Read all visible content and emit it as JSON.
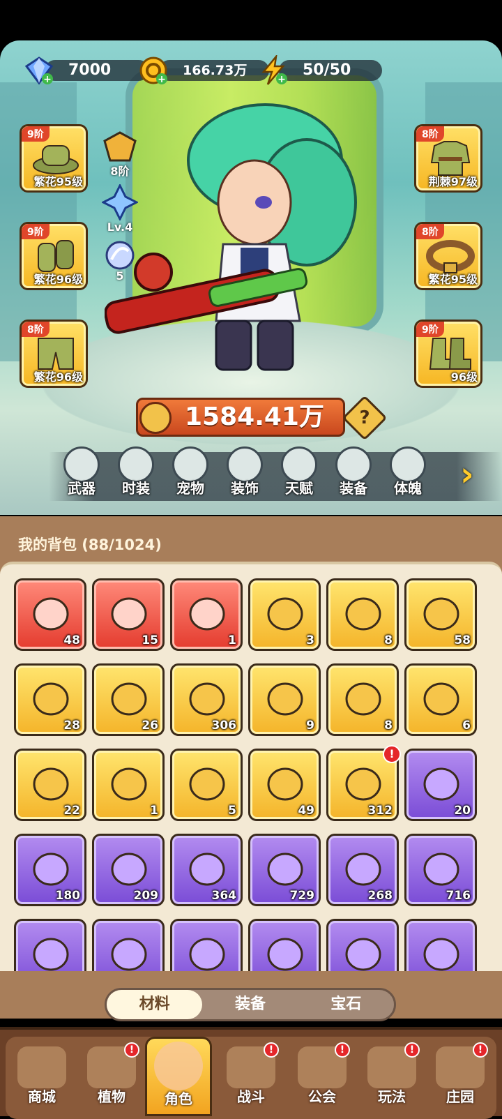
{
  "resources": {
    "diamonds": "7000",
    "gold": "166.73万",
    "energy": "50/50"
  },
  "left_equipment": [
    {
      "tier": "9阶",
      "label": "繁花95级",
      "icon": "hat-icon"
    },
    {
      "tier": "9阶",
      "label": "繁花96级",
      "icon": "gloves-icon"
    },
    {
      "tier": "8阶",
      "label": "繁花96级",
      "icon": "pants-icon"
    }
  ],
  "right_equipment": [
    {
      "tier": "8阶",
      "label": "荆棘97级",
      "icon": "jacket-icon"
    },
    {
      "tier": "8阶",
      "label": "繁花95级",
      "icon": "belt-icon"
    },
    {
      "tier": "9阶",
      "label": "96级",
      "icon": "boots-icon"
    }
  ],
  "side_gems": {
    "tier": "8阶",
    "level": "Lv.4",
    "count": "5"
  },
  "power": "1584.41万",
  "char_tabs": [
    "武器",
    "时装",
    "宠物",
    "装饰",
    "天赋",
    "装备",
    "体魄"
  ],
  "bag": {
    "title": "我的背包 (88/1024)"
  },
  "items": [
    {
      "count": "48",
      "rarity": "red",
      "icon": "crystal-star-icon"
    },
    {
      "count": "15",
      "rarity": "red",
      "icon": "red-potion-icon"
    },
    {
      "count": "1",
      "rarity": "red",
      "icon": "green-capsule-icon"
    },
    {
      "count": "3",
      "rarity": "gold",
      "icon": "skull-scroll-icon"
    },
    {
      "count": "8",
      "rarity": "gold",
      "icon": "key-icon"
    },
    {
      "count": "58",
      "rarity": "gold",
      "icon": "prism-icon"
    },
    {
      "count": "28",
      "rarity": "gold",
      "icon": "golden-flower-icon"
    },
    {
      "count": "26",
      "rarity": "gold",
      "icon": "rune-stone-icon"
    },
    {
      "count": "306",
      "rarity": "gold",
      "icon": "orange-potion-icon"
    },
    {
      "count": "9",
      "rarity": "gold",
      "icon": "sand-pile-icon"
    },
    {
      "count": "8",
      "rarity": "gold",
      "icon": "gold-ore-icon"
    },
    {
      "count": "6",
      "rarity": "gold",
      "icon": "flower-pot-icon"
    },
    {
      "count": "22",
      "rarity": "gold",
      "icon": "spell-book-icon"
    },
    {
      "count": "1",
      "rarity": "gold",
      "icon": "copper-gem-icon"
    },
    {
      "count": "5",
      "rarity": "gold",
      "icon": "lily-icon"
    },
    {
      "count": "49",
      "rarity": "gold",
      "icon": "knot-cookie-icon"
    },
    {
      "count": "312",
      "rarity": "gold",
      "icon": "mystery-flame-icon",
      "alert": "!"
    },
    {
      "count": "20",
      "rarity": "purple",
      "icon": "purple-potion-icon"
    },
    {
      "count": "180",
      "rarity": "purple",
      "icon": "badge-icon"
    },
    {
      "count": "209",
      "rarity": "purple",
      "icon": "leaf-icon"
    },
    {
      "count": "364",
      "rarity": "purple",
      "icon": "scroll-green-icon"
    },
    {
      "count": "729",
      "rarity": "purple",
      "icon": "scroll-purple-icon"
    },
    {
      "count": "268",
      "rarity": "purple",
      "icon": "scroll-blue-icon"
    },
    {
      "count": "716",
      "rarity": "purple",
      "icon": "scroll-red-icon"
    },
    {
      "count": "",
      "rarity": "purple",
      "icon": "gold-item-icon"
    },
    {
      "count": "",
      "rarity": "purple",
      "icon": "potion-icon"
    },
    {
      "count": "",
      "rarity": "purple",
      "icon": "blue-flower-icon"
    },
    {
      "count": "",
      "rarity": "purple",
      "icon": "purple-orb-icon"
    },
    {
      "count": "",
      "rarity": "purple",
      "icon": "pot-icon"
    },
    {
      "count": "",
      "rarity": "purple",
      "icon": "fruit-basket-icon"
    }
  ],
  "segments": [
    "材料",
    "装备",
    "宝石"
  ],
  "bottom_tabs": [
    {
      "label": "商城",
      "alert": ""
    },
    {
      "label": "植物",
      "alert": "!"
    },
    {
      "label": "角色",
      "alert": ""
    },
    {
      "label": "战斗",
      "alert": "!"
    },
    {
      "label": "公会",
      "alert": "!"
    },
    {
      "label": "玩法",
      "alert": "!"
    },
    {
      "label": "庄园",
      "alert": "!"
    }
  ]
}
